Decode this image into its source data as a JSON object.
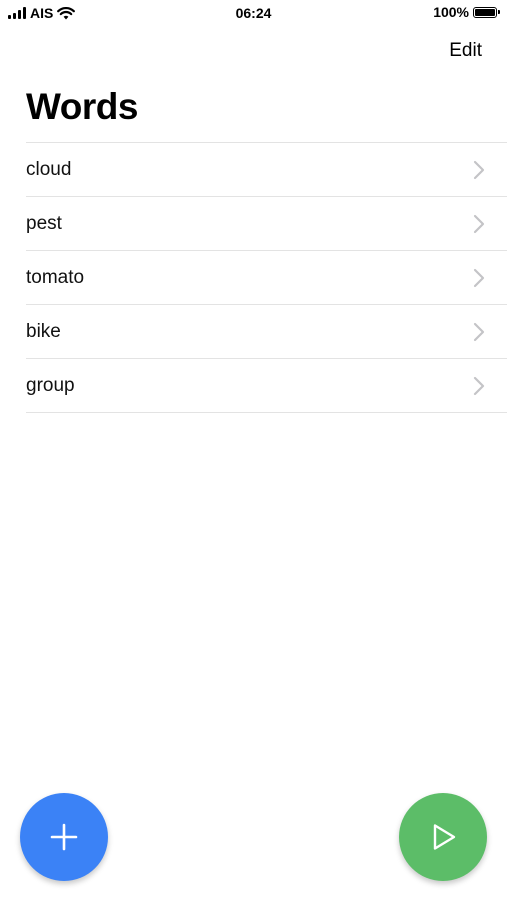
{
  "status_bar": {
    "carrier": "AIS",
    "time": "06:24",
    "battery_percent": "100%",
    "battery_level": 1.0,
    "signal_icon": "signal-bars-icon",
    "wifi_icon": "wifi-icon",
    "battery_icon": "battery-icon"
  },
  "nav": {
    "edit_label": "Edit",
    "title": "Words"
  },
  "words": [
    {
      "label": "cloud"
    },
    {
      "label": "pest"
    },
    {
      "label": "tomato"
    },
    {
      "label": "bike"
    },
    {
      "label": "group"
    }
  ],
  "fab": {
    "add_icon": "plus-icon",
    "play_icon": "play-icon",
    "add_color": "#3b82f6",
    "play_color": "#5cbd68"
  },
  "colors": {
    "separator": "#e3e3e3",
    "chevron": "#c4c4c7"
  }
}
